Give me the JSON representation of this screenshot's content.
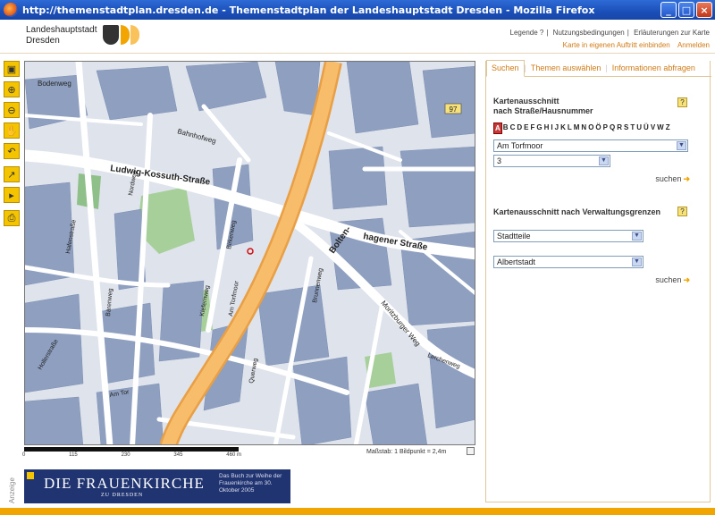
{
  "window": {
    "title": "http://themenstadtplan.dresden.de - Themenstadtplan der Landeshauptstadt Dresden - Mozilla Firefox",
    "buttons": [
      "_",
      "□",
      "×"
    ]
  },
  "header": {
    "logo_line1": "Landeshauptstadt",
    "logo_line2": "Dresden",
    "links_row1": [
      "Legende",
      "?",
      "Nutzungsbedingungen",
      "Erläuterungen zur Karte"
    ],
    "links_row2": [
      "Karte in eigenen Auftritt einbinden",
      "Anmelden"
    ]
  },
  "toolbar": {
    "tools": [
      "full-extent-icon",
      "zoom-in-icon",
      "zoom-out-icon",
      "pan-hand-icon",
      "undo-icon",
      "measure-icon",
      "info-icon",
      "print-icon"
    ]
  },
  "map": {
    "street_labels": [
      "Bodenweg",
      "Bahnhofweg",
      "Ludwig-Kossuth-Straße",
      "Bolten-",
      "hagener Straße",
      "Am Torfmoor",
      "Hafenstraße",
      "Moritzburger Weg",
      "Am Tor",
      "Kiefernweg",
      "Nordweg",
      "Bärenweg",
      "Birkenweg",
      "Brunnenweg",
      "Querweg",
      "Lerchenweg",
      "Hollerstraße"
    ],
    "route_badge": "97"
  },
  "scale": {
    "ticks": [
      "0",
      "115",
      "230",
      "345",
      "460 m"
    ],
    "text": "Maßstab: 1 Bildpunkt = 2,4m"
  },
  "ad": {
    "label": "Anzeige",
    "title": "DIE FRAUENKIRCHE",
    "subtitle": "ZU DRESDEN",
    "blurb": "Das Buch zur Weihe der Frauenkirche am 30. Oktober 2005"
  },
  "panel": {
    "tabs": [
      "Suchen",
      "Themen auswählen",
      "Informationen abfragen"
    ],
    "section1": {
      "title_line1": "Kartenausschnitt",
      "title_line2": "nach Straße/Hausnummer",
      "help": "?",
      "alphabet": [
        "A",
        "B",
        "C",
        "D",
        "E",
        "F",
        "G",
        "H",
        "I",
        "J",
        "K",
        "L",
        "M",
        "N",
        "O",
        "Ö",
        "P",
        "Q",
        "R",
        "S",
        "T",
        "U",
        "Ü",
        "V",
        "W",
        "Z"
      ],
      "selected_letter": "A",
      "street_value": "Am Torfmoor",
      "number_value": "3",
      "search_label": "suchen"
    },
    "section2": {
      "title": "Kartenausschnitt nach Verwaltungsgrenzen",
      "help": "?",
      "type_value": "Stadtteile",
      "district_value": "Albertstadt",
      "search_label": "suchen"
    }
  },
  "colors": {
    "accent": "#d07a14",
    "highway": "#f2b15a",
    "buildings": "#8e9fc0",
    "green": "#a6cf9a",
    "titlebar": "#1a4fb8"
  }
}
